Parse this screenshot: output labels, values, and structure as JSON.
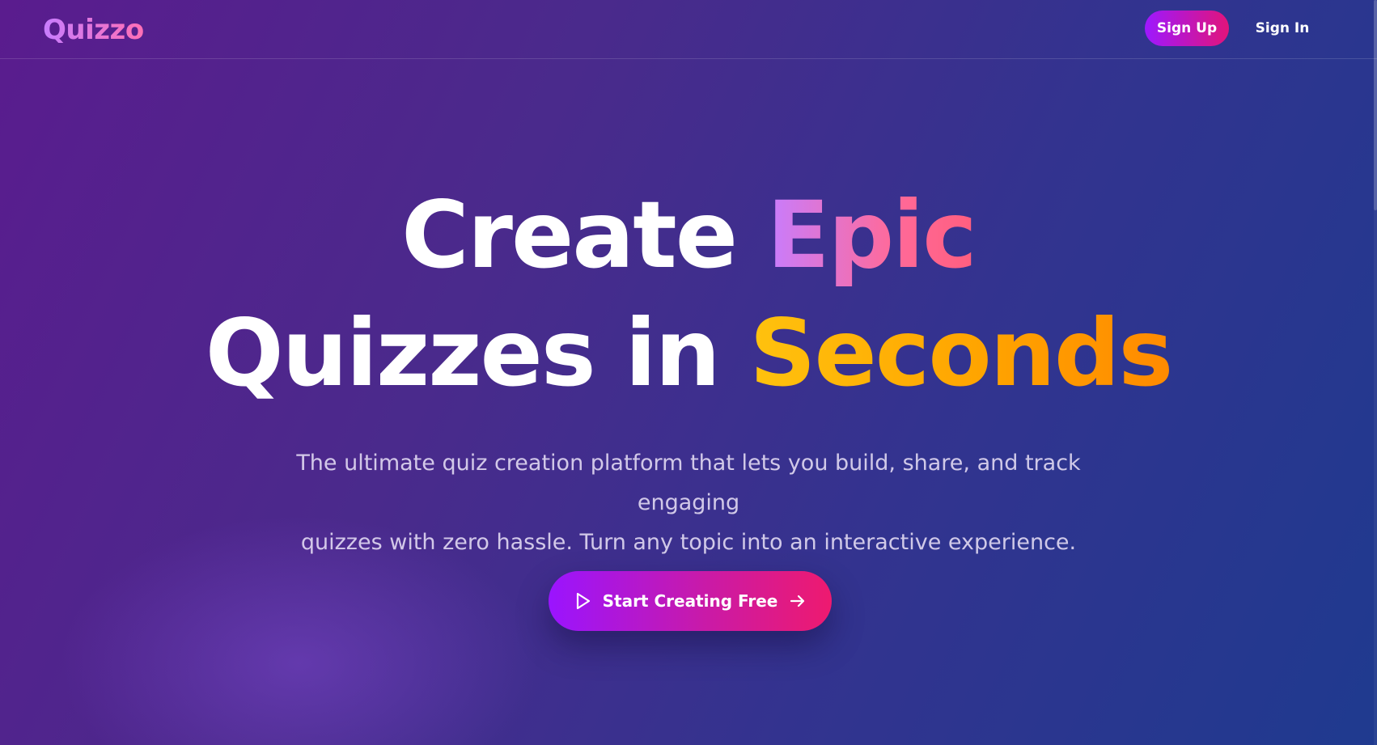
{
  "header": {
    "logo": "Quizzo",
    "signup_label": "Sign Up",
    "signin_label": "Sign In"
  },
  "hero": {
    "headline": {
      "line1_plain": "Create",
      "line1_accent": "Epic",
      "line2_plain": "Quizzes in",
      "line2_accent": "Seconds"
    },
    "subtitle_line1": "The ultimate quiz creation platform that lets you build, share, and track engaging",
    "subtitle_line2": "quizzes with zero hassle. Turn any topic into an interactive experience.",
    "cta": {
      "label": "Start Creating Free",
      "leading_icon": "play-icon",
      "trailing_icon": "arrow-right-icon"
    }
  },
  "colors": {
    "background_start": "#5a1c8e",
    "background_end": "#1f3a8f",
    "button_gradient_start": "#9a14ff",
    "button_gradient_end": "#ee1a6f",
    "accent_pink": "#ff6a9a",
    "accent_purple": "#c77dff",
    "accent_orange": "#ffa400"
  }
}
